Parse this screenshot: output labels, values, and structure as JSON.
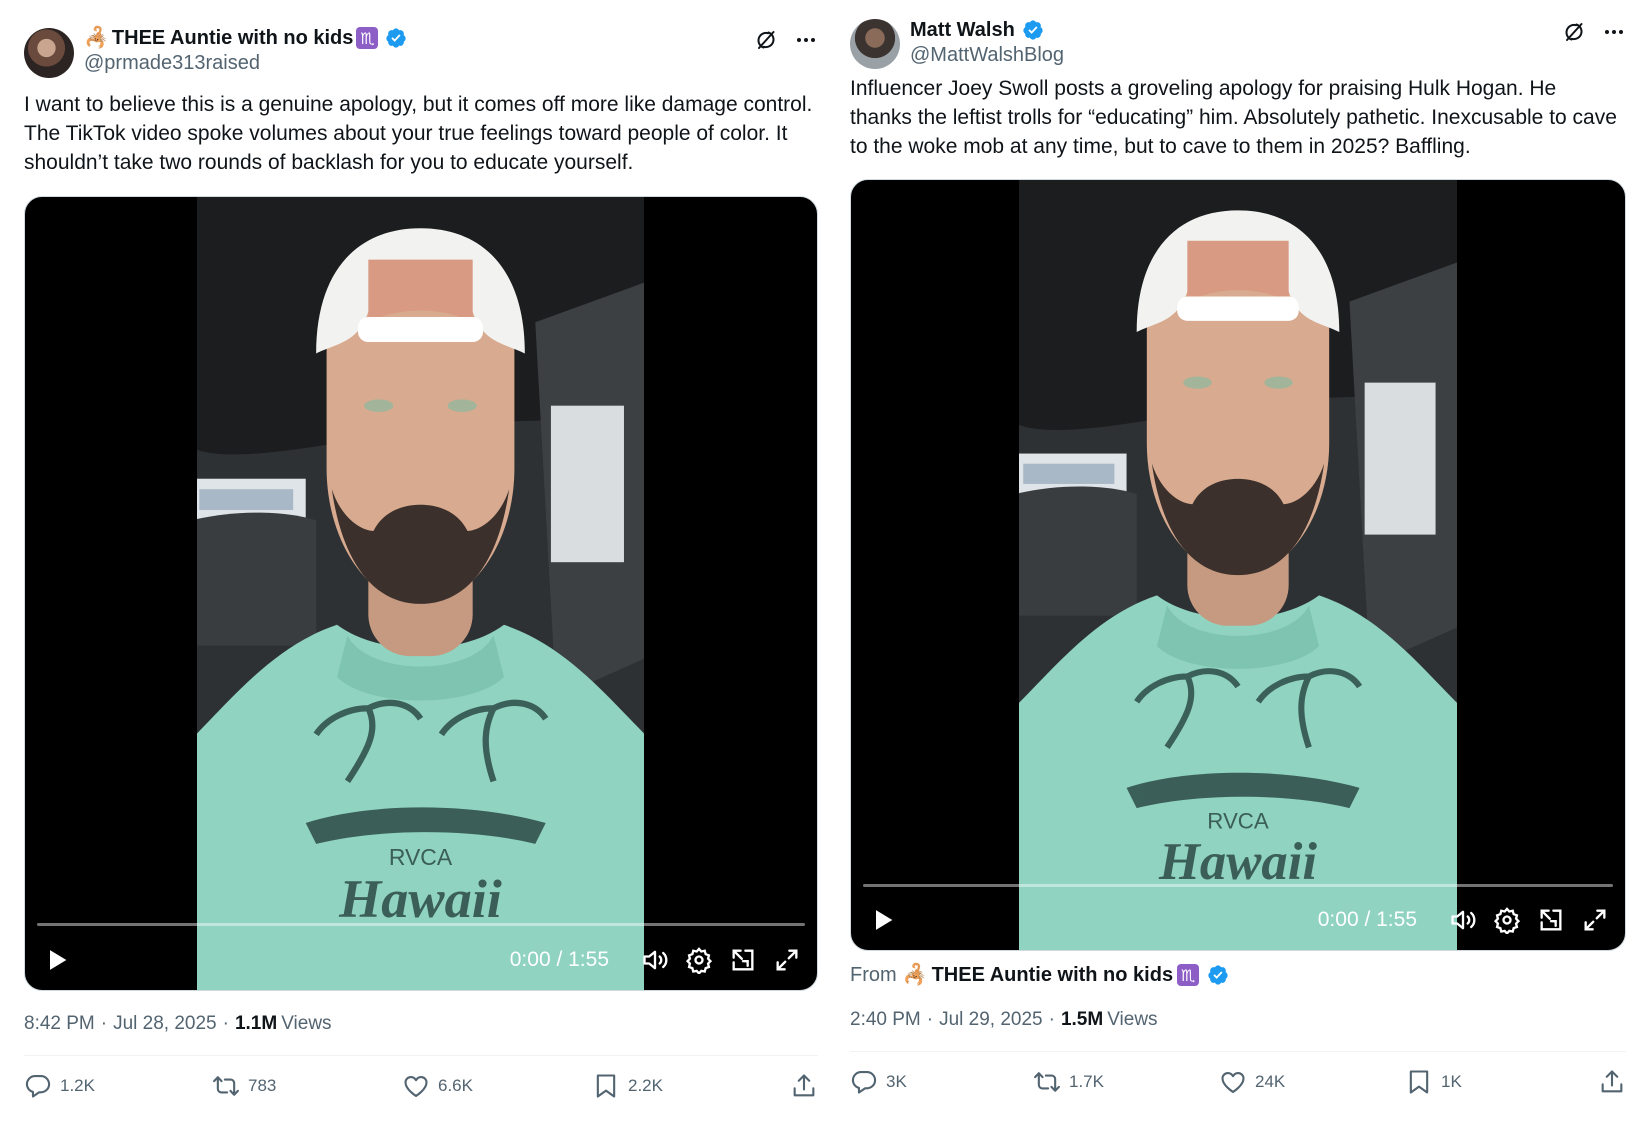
{
  "tweets": [
    {
      "display_name": "THEE Auntie with no kids",
      "name_emoji": "🦂",
      "zodiac": "♏",
      "handle": "@prmade313raised",
      "text": "I want to believe this is a genuine apology, but it comes off more like damage control. The TikTok video spoke volumes about your true feelings toward people of color. It shouldn’t take two rounds of backlash for you to educate yourself.",
      "video": {
        "time": "0:00 / 1:55"
      },
      "meta": {
        "time": "8:42 PM",
        "date": "Jul 28, 2025",
        "views": "1.1M",
        "views_label": "Views"
      },
      "actions": {
        "replies": "1.2K",
        "reposts": "783",
        "likes": "6.6K",
        "bookmarks": "2.2K"
      }
    },
    {
      "display_name": "Matt Walsh",
      "handle": "@MattWalshBlog",
      "text": "Influencer Joey Swoll posts a groveling apology for praising Hulk Hogan. He thanks the leftist trolls for “educating” him. Absolutely pathetic. Inexcusable to cave to the woke mob at any time, but to cave to them in 2025? Baffling.",
      "video": {
        "time": "0:00 / 1:55"
      },
      "from": {
        "label": "From",
        "name": "THEE Auntie with no kids",
        "emoji": "🦂",
        "zodiac": "♏"
      },
      "meta": {
        "time": "2:40 PM",
        "date": "Jul 29, 2025",
        "views": "1.5M",
        "views_label": "Views"
      },
      "actions": {
        "replies": "3K",
        "reposts": "1.7K",
        "likes": "24K",
        "bookmarks": "1K"
      }
    }
  ],
  "icons": {
    "verified": "verified-badge-icon",
    "grok": "grok-icon",
    "more": "more-icon",
    "play": "play-icon",
    "volume": "volume-icon",
    "settings": "settings-icon",
    "dock": "dock-icon",
    "fullscreen": "fullscreen-icon",
    "reply": "reply-icon",
    "repost": "repost-icon",
    "like": "like-icon",
    "bookmark": "bookmark-icon",
    "share": "share-icon"
  },
  "colors": {
    "verified": "#1d9bf0",
    "zodiac": "#8e5ec7",
    "secondary_text": "#536471",
    "primary_text": "#0f1419",
    "shirt": "#8fd3c0"
  }
}
